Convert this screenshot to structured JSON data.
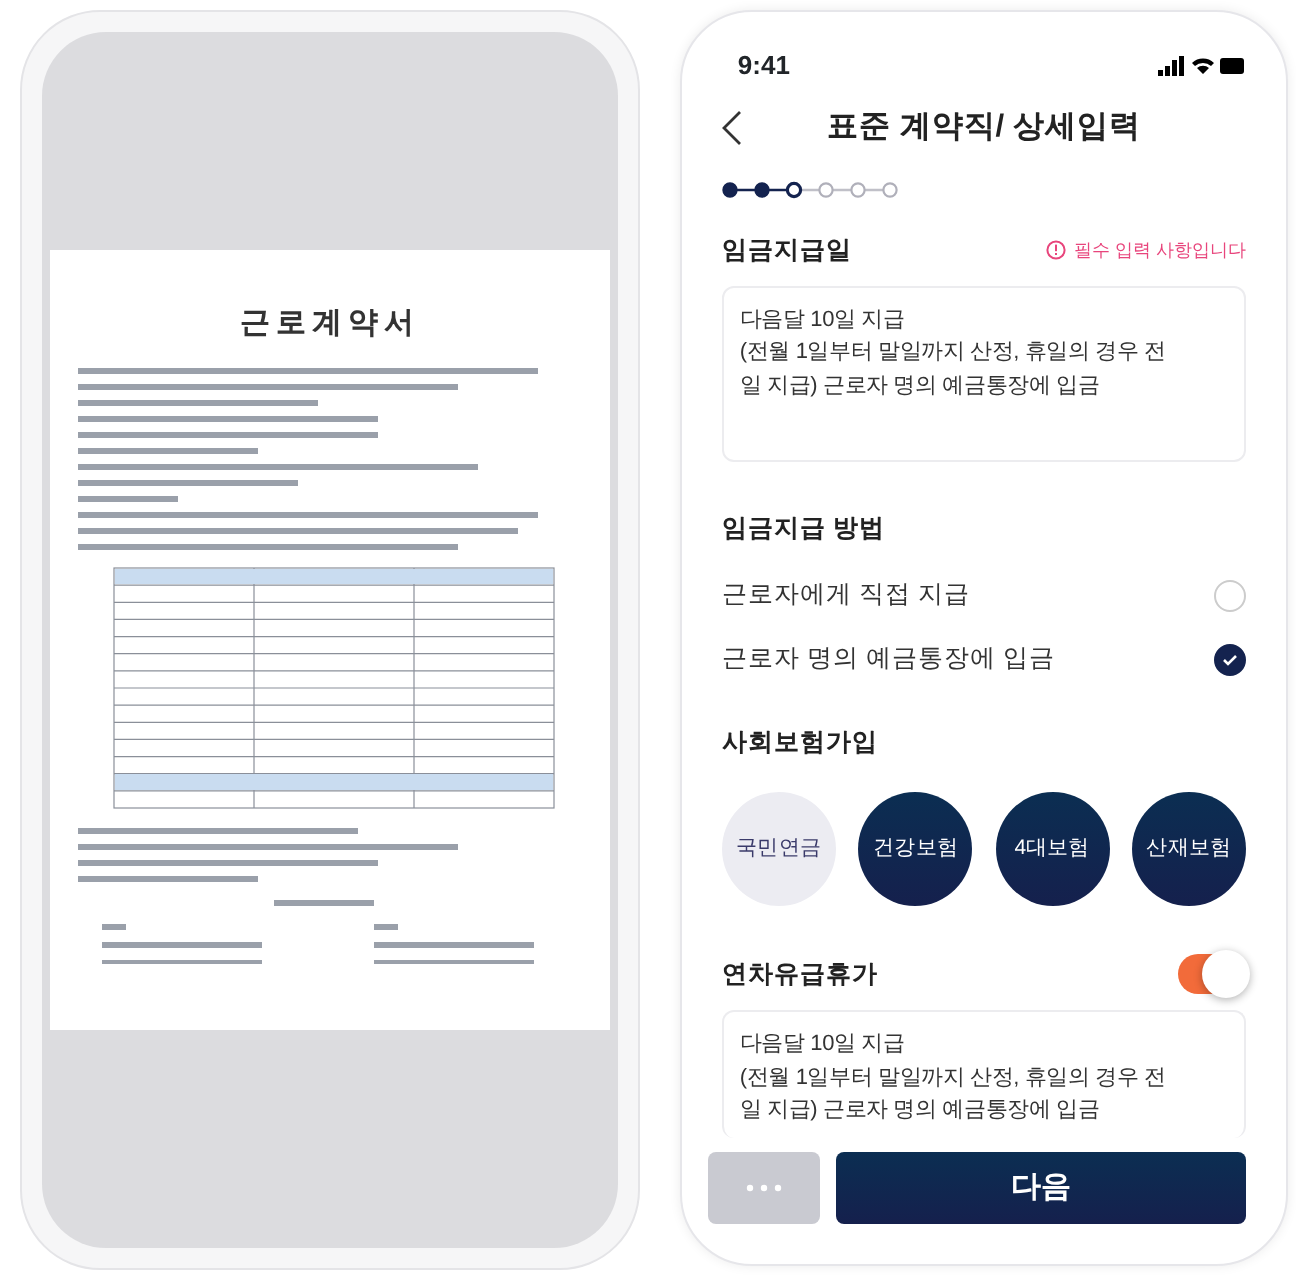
{
  "left_phone": {
    "document": {
      "title": "근로계약서"
    }
  },
  "right_phone": {
    "status_bar": {
      "time": "9:41"
    },
    "header": {
      "title": "표준 계약직/ 상세입력"
    },
    "steps": [
      {
        "completed": true,
        "current": false
      },
      {
        "completed": true,
        "current": false
      },
      {
        "completed": false,
        "current": true
      },
      {
        "completed": false,
        "current": false
      },
      {
        "completed": false,
        "current": false
      },
      {
        "completed": false,
        "current": false
      }
    ],
    "wage_date": {
      "label": "임금지급일",
      "notice": "필수 입력 사항입니다",
      "lines": [
        "다음달 10일 지급",
        "(전월 1일부터 말일까지 산정, 휴일의 경우 전",
        "일 지급) 근로자 명의 예금통장에 입금"
      ]
    },
    "wage_method": {
      "label": "임금지급 방법",
      "options": [
        {
          "label": "근로자에게 직접 지급",
          "selected": false
        },
        {
          "label": "근로자 명의 예금통장에 입금",
          "selected": true
        }
      ]
    },
    "insurance": {
      "label": "사회보험가입",
      "options": [
        {
          "label": "국민연금",
          "selected": false
        },
        {
          "label": "건강보험",
          "selected": true
        },
        {
          "label": "4대보험",
          "selected": true
        },
        {
          "label": "산재보험",
          "selected": true
        }
      ]
    },
    "annual_leave": {
      "label": "연차유급휴가",
      "on": true,
      "lines": [
        "다음달 10일 지급",
        "(전월 1일부터 말일까지 산정, 휴일의 경우 전",
        "일 지급) 근로자 명의 예금통장에 입금"
      ]
    },
    "buttons": {
      "next": "다음"
    }
  }
}
